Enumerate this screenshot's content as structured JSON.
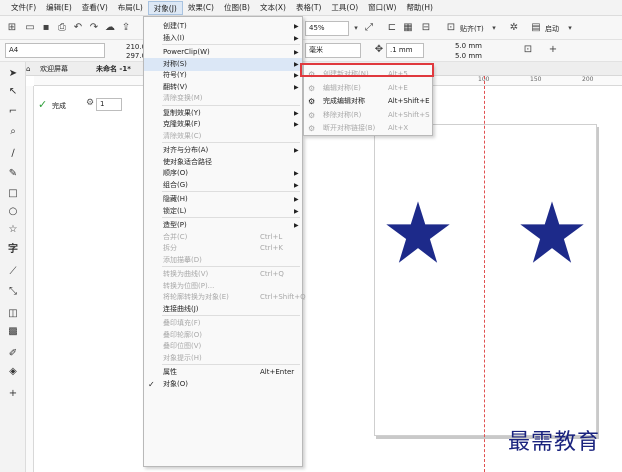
{
  "menubar": {
    "items": [
      {
        "label": "文件(F)"
      },
      {
        "label": "编辑(E)"
      },
      {
        "label": "查看(V)"
      },
      {
        "label": "布局(L)"
      },
      {
        "label": "对象(J)",
        "active": true
      },
      {
        "label": "效果(C)"
      },
      {
        "label": "位图(B)"
      },
      {
        "label": "文本(X)"
      },
      {
        "label": "表格(T)"
      },
      {
        "label": "工具(O)"
      },
      {
        "label": "窗口(W)"
      },
      {
        "label": "帮助(H)"
      }
    ]
  },
  "toolbar": {
    "zoom": "45%",
    "snap_label": "贴齐(T)",
    "launch_label": "启动"
  },
  "propbar": {
    "page_size": "A4",
    "width": "210.0",
    "height": "297.0",
    "units": "毫米",
    "nudge": ".1 mm",
    "dup_x": "5.0 mm",
    "dup_y": "5.0 mm"
  },
  "tabs": {
    "welcome": "欢迎屏幕",
    "doc": "未命名 -1*"
  },
  "donebar": {
    "done_label": "完成",
    "count": "1"
  },
  "ruler": {
    "marks": [
      "100",
      "150",
      "200"
    ]
  },
  "object_menu": {
    "items": [
      {
        "label": "创建(T)",
        "arrow": true
      },
      {
        "label": "插入(I)",
        "arrow": true
      },
      {
        "sep": true
      },
      {
        "label": "PowerClip(W)",
        "arrow": true
      },
      {
        "label": "对称(S)",
        "arrow": true,
        "highlight": true
      },
      {
        "label": "符号(Y)",
        "arrow": true
      },
      {
        "label": "翻转(V)",
        "arrow": true
      },
      {
        "label": "清除变换(M)",
        "disabled": true
      },
      {
        "sep": true
      },
      {
        "label": "复制效果(Y)",
        "arrow": true
      },
      {
        "label": "克隆效果(F)",
        "arrow": true
      },
      {
        "label": "清除效果(C)",
        "disabled": true
      },
      {
        "sep": true
      },
      {
        "label": "对齐与分布(A)",
        "arrow": true
      },
      {
        "label": "使对象适合路径"
      },
      {
        "label": "顺序(O)",
        "arrow": true
      },
      {
        "label": "组合(G)",
        "arrow": true
      },
      {
        "sep": true
      },
      {
        "label": "隐藏(H)",
        "arrow": true
      },
      {
        "label": "锁定(L)",
        "arrow": true
      },
      {
        "sep": true
      },
      {
        "label": "造型(P)",
        "arrow": true
      },
      {
        "label": "合并(C)",
        "shortcut": "Ctrl+L",
        "disabled": true
      },
      {
        "label": "拆分",
        "shortcut": "Ctrl+K",
        "disabled": true
      },
      {
        "label": "添加描摹(D)",
        "disabled": true
      },
      {
        "sep": true
      },
      {
        "label": "转换为曲线(V)",
        "shortcut": "Ctrl+Q",
        "disabled": true
      },
      {
        "label": "转换为位图(P)...",
        "disabled": true
      },
      {
        "label": "将轮廓转换为对象(E)",
        "shortcut": "Ctrl+Shift+Q",
        "disabled": true
      },
      {
        "label": "连接曲线(J)"
      },
      {
        "sep": true
      },
      {
        "label": "叠印填充(F)",
        "disabled": true
      },
      {
        "label": "叠印轮廓(O)",
        "disabled": true
      },
      {
        "label": "叠印位图(V)",
        "disabled": true
      },
      {
        "label": "对象提示(H)",
        "disabled": true
      },
      {
        "sep": true
      },
      {
        "label": "属性",
        "shortcut": "Alt+Enter"
      },
      {
        "label": "对象(O)",
        "checked": true
      }
    ]
  },
  "symmetry_menu": {
    "items": [
      {
        "label": "创建新对称(N)",
        "shortcut": "Alt+5",
        "disabled": true
      },
      {
        "label": "编辑对称(E)",
        "shortcut": "Alt+E",
        "disabled": true
      },
      {
        "label": "完成编辑对称",
        "shortcut": "Alt+Shift+E"
      },
      {
        "label": "移除对称(R)",
        "shortcut": "Alt+Shift+S",
        "disabled": true
      },
      {
        "label": "断开对称链接(B)",
        "shortcut": "Alt+X",
        "disabled": true
      }
    ]
  },
  "colors": {
    "star": "#1d2a8a",
    "highlight": "#e0393e"
  },
  "watermark": "最需教育"
}
